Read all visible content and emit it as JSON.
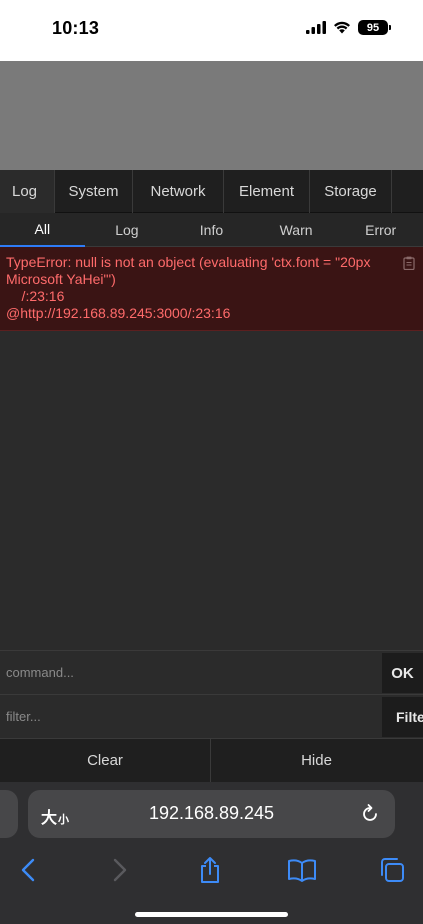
{
  "status_bar": {
    "time": "10:13",
    "battery": "95"
  },
  "console": {
    "main_tabs": [
      "Log",
      "System",
      "Network",
      "Element",
      "Storage"
    ],
    "sub_tabs": [
      "All",
      "Log",
      "Info",
      "Warn",
      "Error"
    ],
    "active_sub_tab": "All",
    "error": {
      "line1": "TypeError: null is not an object (evaluating 'ctx.font = \"20px",
      "line2": "Microsoft YaHei\"')",
      "line3": "    /:23:16",
      "line4": "@http://192.168.89.245:3000/:23:16"
    },
    "command_placeholder": "command...",
    "ok_label": "OK",
    "filter_placeholder": "filter...",
    "filter_label": "Filter",
    "clear_label": "Clear",
    "hide_label": "Hide"
  },
  "safari": {
    "aa_big": "大",
    "aa_small": "小",
    "url": "192.168.89.245"
  },
  "colors": {
    "error_text": "#ff6b6b",
    "error_bg": "#3a1414",
    "active_tab_underline": "#2e7cf6",
    "safari_icon": "#3d8bf7"
  },
  "icons": [
    "signal-icon",
    "wifi-icon",
    "copy-icon",
    "reload-icon",
    "back-icon",
    "forward-icon",
    "share-icon",
    "bookmarks-icon",
    "tabs-icon"
  ]
}
